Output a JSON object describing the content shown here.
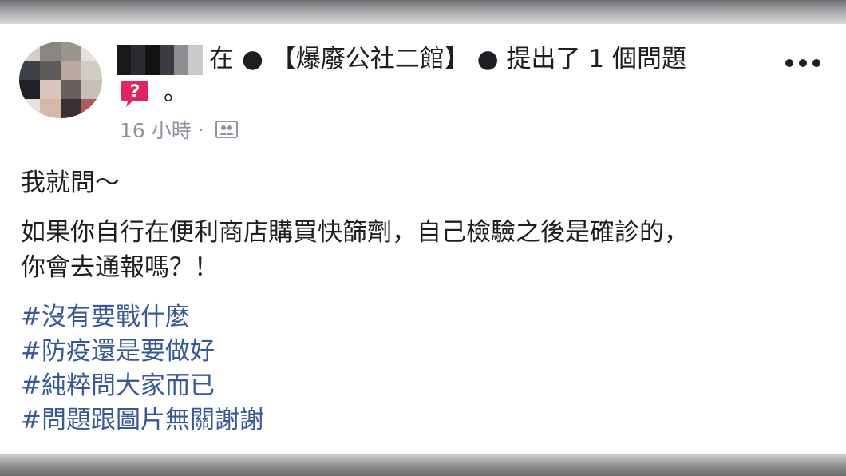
{
  "post": {
    "header_line": "在 ● 【爆廢公社二館】 ● 提出了 1 個問題",
    "header_period": "。",
    "time_label": "16 小時",
    "meta_separator": "·",
    "icons": {
      "more": "more-options-icon",
      "question": "question-bubble-icon",
      "audience": "friends-audience-icon"
    },
    "body": {
      "line1": "我就問～",
      "line2": "如果你自行在便利商店購買快篩劑，自己檢驗之後是確診的，",
      "line3": "你會去通報嗎？！"
    },
    "hashtags": [
      "#沒有要戰什麼",
      "#防疫還是要做好",
      "#純粹問大家而已",
      "#問題跟圖片無關謝謝"
    ],
    "colors": {
      "hashtag": "#385898",
      "text": "#1c1e21",
      "meta": "#8d949e",
      "question_badge": "#e0245e"
    }
  }
}
